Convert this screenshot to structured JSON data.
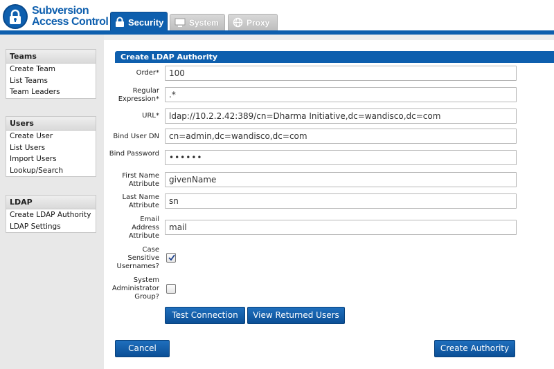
{
  "app": {
    "title_line1": "Subversion",
    "title_line2": "Access Control"
  },
  "tabs": [
    {
      "label": "Security",
      "icon": "lock-icon",
      "active": true
    },
    {
      "label": "System",
      "icon": "monitor-icon",
      "active": false
    },
    {
      "label": "Proxy",
      "icon": "globe-icon",
      "active": false
    }
  ],
  "sidebar": {
    "teams": {
      "heading": "Teams",
      "items": [
        "Create Team",
        "List Teams",
        "Team Leaders"
      ]
    },
    "users": {
      "heading": "Users",
      "items": [
        "Create User",
        "List Users",
        "Import Users",
        "Lookup/Search"
      ]
    },
    "ldap": {
      "heading": "LDAP",
      "items": [
        "Create LDAP Authority",
        "LDAP Settings"
      ]
    }
  },
  "form": {
    "title": "Create LDAP Authority",
    "order": {
      "label": "Order*",
      "value": "100"
    },
    "regex": {
      "label": "Regular Expression*",
      "value": ".*"
    },
    "url": {
      "label": "URL*",
      "value": "ldap://10.2.2.42:389/cn=Dharma Initiative,dc=wandisco,dc=com"
    },
    "bind_dn": {
      "label": "Bind User DN",
      "value": "cn=admin,dc=wandisco,dc=com"
    },
    "bind_password": {
      "label": "Bind Password",
      "value": "••••••"
    },
    "first_name": {
      "label": "First Name Attribute",
      "value": "givenName"
    },
    "last_name": {
      "label": "Last Name Attribute",
      "value": "sn"
    },
    "email": {
      "label": "Email Address Attribute",
      "value": "mail"
    },
    "case_sensitive": {
      "label": "Case Sensitive Usernames?",
      "checked": true
    },
    "sys_admin": {
      "label": "System Administrator Group?",
      "checked": false
    },
    "test_connection_label": "Test Connection",
    "view_users_label": "View Returned Users",
    "cancel_label": "Cancel",
    "create_label": "Create Authority"
  },
  "colors": {
    "brand": "#0e5fae",
    "sidebar_bg": "#e8e8e8"
  }
}
